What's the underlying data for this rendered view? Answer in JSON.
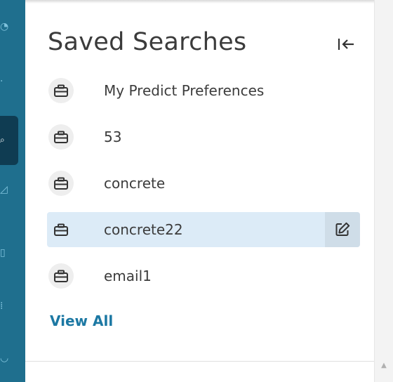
{
  "panel": {
    "title": "Saved Searches",
    "view_all_label": "View All"
  },
  "items": [
    {
      "label": "My Predict Preferences",
      "icon": "briefcase-icon",
      "selected": false
    },
    {
      "label": "53",
      "icon": "briefcase-icon",
      "selected": false
    },
    {
      "label": "concrete",
      "icon": "briefcase-icon",
      "selected": false
    },
    {
      "label": "concrete22",
      "icon": "briefcase-icon",
      "selected": true
    },
    {
      "label": "email1",
      "icon": "briefcase-icon",
      "selected": false
    }
  ],
  "colors": {
    "rail": "#1f6f8e",
    "rail_active": "#0f3c52",
    "selected_row": "#dcebf7",
    "link": "#1c78a3"
  }
}
